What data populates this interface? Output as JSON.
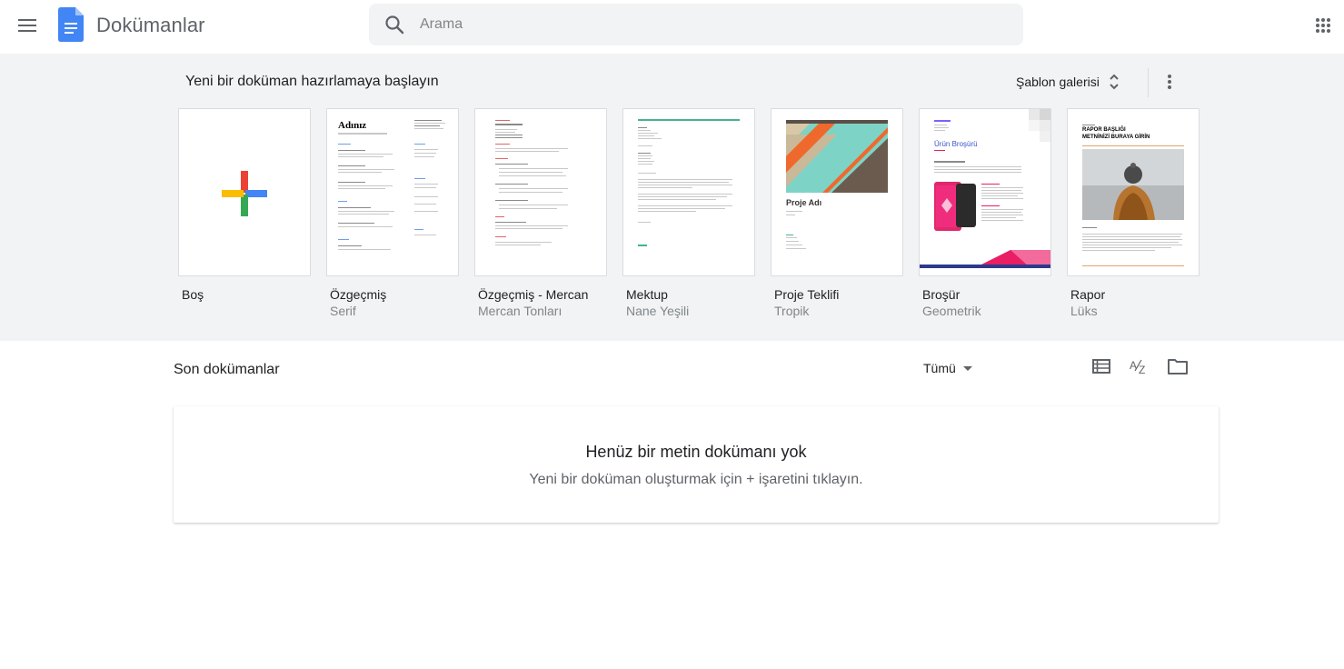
{
  "header": {
    "app_title": "Dokümanlar",
    "search_placeholder": "Arama",
    "menu_icon": "hamburger-menu-icon",
    "apps_icon": "apps-grid-icon",
    "logo_color": "#4285f4"
  },
  "templates": {
    "heading": "Yeni bir doküman hazırlamaya başlayın",
    "gallery_label": "Şablon galerisi",
    "items": [
      {
        "name": "Boş",
        "sub": ""
      },
      {
        "name": "Özgeçmiş",
        "sub": "Serif"
      },
      {
        "name": "Özgeçmiş - Mercan",
        "sub": "Mercan Tonları"
      },
      {
        "name": "Mektup",
        "sub": "Nane Yeşili"
      },
      {
        "name": "Proje Teklifi",
        "sub": "Tropik"
      },
      {
        "name": "Broşür",
        "sub": "Geometrik"
      },
      {
        "name": "Rapor",
        "sub": "Lüks"
      }
    ],
    "thumbs": {
      "resume_title": "Adınız",
      "proposal_title": "Proje Adı",
      "brochure_title": "Ürün Broşürü",
      "report_title": "RAPOR BAŞLIĞI",
      "report_subtitle": "METNİNİZİ BURAYA GİRİN"
    }
  },
  "recent": {
    "title": "Son dokümanlar",
    "filter_label": "Tümü",
    "empty_title": "Henüz bir metin dokümanı yok",
    "empty_sub": "Yeni bir doküman oluşturmak için + işaretini tıklayın."
  },
  "colors": {
    "header_bg": "#ffffff",
    "templates_bg": "#f1f3f4",
    "plus_red": "#ea4335",
    "plus_blue": "#4285f4",
    "plus_green": "#34a853",
    "plus_yellow": "#fbbc04"
  }
}
